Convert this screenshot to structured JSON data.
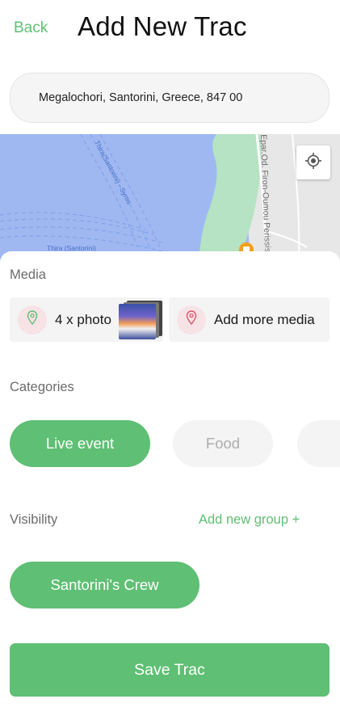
{
  "header": {
    "back_label": "Back",
    "title": "Add New Trac"
  },
  "address": {
    "value": "Megalochori, Santorini, Greece, 847 00"
  },
  "map": {
    "road_label": "Epar.Od. Firon-Oumou Perissis",
    "ferry_route_1": "Thira(Santorini) - Syros",
    "ferry_route_2": "Thira (Santorini)",
    "sea_color": "#9fb8f2",
    "land_color": "#b5e3c3"
  },
  "media": {
    "label": "Media",
    "photos_label": "4 x photo",
    "add_label": "Add more media"
  },
  "categories": {
    "label": "Categories",
    "items": [
      {
        "label": "Live event",
        "selected": true
      },
      {
        "label": "Food",
        "selected": false
      },
      {
        "label": "",
        "selected": false
      }
    ]
  },
  "visibility": {
    "label": "Visibility",
    "add_group_label": "Add new group +",
    "groups": [
      {
        "label": "Santorini's Crew",
        "selected": true
      }
    ]
  },
  "save_label": "Save Trac",
  "colors": {
    "accent": "#5fbf74",
    "chip_inactive_bg": "#f4f4f4",
    "pin_bg": "#f7e3e6"
  }
}
